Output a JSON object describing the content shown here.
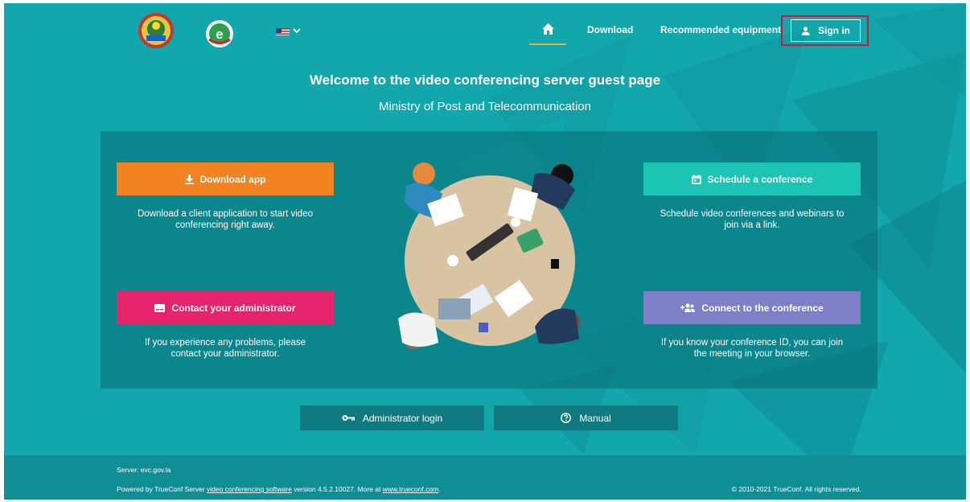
{
  "header": {
    "nav_download": "Download",
    "nav_equipment": "Recommended equipment",
    "signin_label": "Sign in"
  },
  "hero": {
    "title": "Welcome to the video conferencing server guest page",
    "subtitle": "Ministry of Post and Telecommunication"
  },
  "actions": {
    "download": {
      "label": "Download app",
      "desc": [
        "Download a client application to start video",
        "conferencing right away."
      ]
    },
    "contact": {
      "label": "Contact your administrator",
      "desc": [
        "If you experience any problems, please",
        "contact your administrator."
      ]
    },
    "schedule": {
      "label": "Schedule a conference",
      "desc": [
        "Schedule video conferences and webinars to",
        "join via a link."
      ]
    },
    "connect": {
      "label": "Connect to the conference",
      "desc": [
        "If you know your conference ID, you can join",
        "the meeting in your browser."
      ]
    }
  },
  "bottom": {
    "admin_login": "Administrator login",
    "manual": "Manual"
  },
  "footer": {
    "server": "Server: evc.gov.la",
    "powered_prefix": "Powered by TrueConf Server ",
    "powered_link": "video conferencing software",
    "powered_mid": " version 4.5.2.10027. More at ",
    "site_link": "www.trueconf.com",
    "powered_suffix": ".",
    "copyright": "© 2010-2021 TrueConf. All rights reserved."
  },
  "colors": {
    "background": "#12a7ad",
    "download": "#f28322",
    "contact": "#e6246b",
    "schedule": "#1cc4b4",
    "connect": "#7d80c7",
    "signin_highlight": "#c01d3a"
  },
  "icons": {
    "home": "home-icon",
    "download": "download-icon",
    "contact": "card-icon",
    "schedule": "calendar-icon",
    "connect": "add-people-icon",
    "admin": "key-icon",
    "manual": "help-icon",
    "signin": "person-icon"
  }
}
